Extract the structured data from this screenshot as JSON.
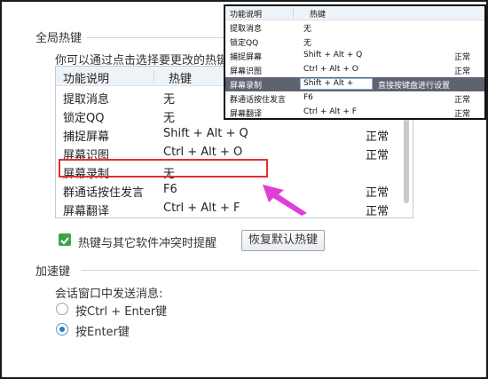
{
  "global_hotkeys": {
    "section_title": "全局热键",
    "hint": "你可以通过点击选择要更改的热键。",
    "table": {
      "headers": [
        "功能说明",
        "热键"
      ],
      "rows": [
        {
          "function": "提取消息",
          "hotkey": "无",
          "status": ""
        },
        {
          "function": "锁定QQ",
          "hotkey": "无",
          "status": ""
        },
        {
          "function": "捕捉屏幕",
          "hotkey": "Shift + Alt + Q",
          "status": "正常"
        },
        {
          "function": "屏幕识图",
          "hotkey": "Ctrl + Alt + O",
          "status": "正常"
        },
        {
          "function": "屏幕录制",
          "hotkey": "无",
          "status": ""
        },
        {
          "function": "群通话按住发言",
          "hotkey": "F6",
          "status": "正常"
        },
        {
          "function": "屏幕翻译",
          "hotkey": "Ctrl + Alt + F",
          "status": "正常"
        }
      ]
    },
    "conflict_checkbox": {
      "label": "热键与其它软件冲突时提醒",
      "checked": true
    },
    "restore_button": "恢复默认热键"
  },
  "accelerator": {
    "section_title": "加速键",
    "sub_label": "会话窗口中发送消息:",
    "options": [
      {
        "label": "按Ctrl + Enter键",
        "checked": false
      },
      {
        "label": "按Enter键",
        "checked": true
      }
    ]
  },
  "inset": {
    "headers": [
      "功能说明",
      "热键"
    ],
    "rows": [
      {
        "function": "提取消息",
        "hotkey": "无",
        "status": ""
      },
      {
        "function": "锁定QQ",
        "hotkey": "无",
        "status": ""
      },
      {
        "function": "捕捉屏幕",
        "hotkey": "Shift + Alt + Q",
        "status": "正常"
      },
      {
        "function": "屏幕识图",
        "hotkey": "Ctrl + Alt + O",
        "status": "正常"
      },
      {
        "function": "屏幕录制",
        "hotkey": "Shift + Alt +",
        "status": "",
        "hint": "直接按键盘进行设置"
      },
      {
        "function": "群通话按住发言",
        "hotkey": "F6",
        "status": "正常"
      },
      {
        "function": "屏幕翻译",
        "hotkey": "Ctrl + Alt + F",
        "status": "正常"
      }
    ]
  },
  "colors": {
    "highlight_box": "#e0312f",
    "arrow": "#e03fd6",
    "checkbox": "#3fa34d",
    "radio_selected": "#2b7bd3",
    "inset_selected_row": "#5d6470"
  },
  "icons": {
    "arrow": "magenta-pointer-arrow-icon",
    "check": "checkmark-icon"
  }
}
